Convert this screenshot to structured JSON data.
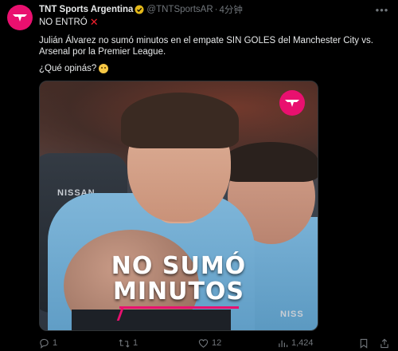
{
  "tweet": {
    "display_name": "TNT Sports Argentina",
    "handle": "@TNTSportsAR",
    "separator": "·",
    "time": "4分钟",
    "line1": "NO ENTRÓ",
    "line1_emoji": "✕",
    "body": "Julián Álvarez no sumó minutos en el empate SIN GOLES del Manchester City vs. Arsenal por la Premier League.",
    "question": "¿Qué opinás?",
    "media": {
      "overlay_line1": "NO SUMÓ",
      "overlay_line2": "MINUTOS",
      "sponsor_left": "NISSAN",
      "sponsor_right": "NISS"
    },
    "actions": {
      "replies": "1",
      "retweets": "1",
      "likes": "12",
      "views": "1,424"
    },
    "colors": {
      "brand_pink": "#e9106f",
      "verified_gold": "#e2b719",
      "muted": "#71767b"
    }
  }
}
